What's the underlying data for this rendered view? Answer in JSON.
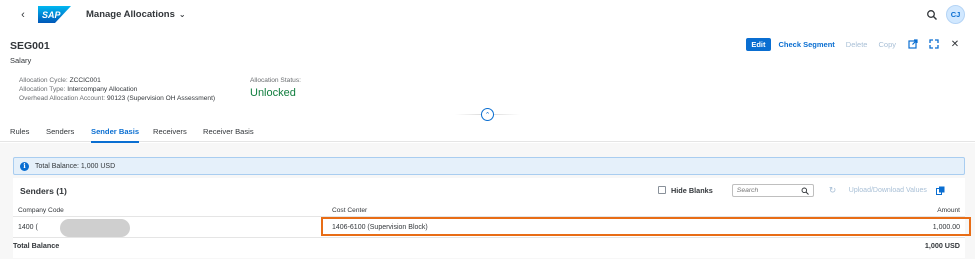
{
  "shell": {
    "back_icon": "chevron-left-icon",
    "logo_text": "SAP",
    "app_title": "Manage Allocations",
    "app_title_icon": "chevron-down-icon",
    "search_icon": "search-icon",
    "avatar_initials": "CJ"
  },
  "header": {
    "title": "SEG001",
    "subtitle": "Salary",
    "actions": {
      "edit": "Edit",
      "check_segment": "Check Segment",
      "delete": "Delete",
      "copy": "Copy"
    },
    "action_icons": [
      "share-icon",
      "fullscreen-icon",
      "close-icon"
    ],
    "attributes": [
      {
        "label": "Allocation Cycle:",
        "value": "ZCCIC001"
      },
      {
        "label": "Allocation Type:",
        "value": "Intercompany Allocation"
      },
      {
        "label": "Overhead Allocation Account:",
        "value": "90123 (Supervision OH Assessment)"
      }
    ],
    "status": {
      "label": "Allocation Status:",
      "value": "Unlocked"
    }
  },
  "tabs": [
    {
      "label": "Rules",
      "active": false
    },
    {
      "label": "Senders",
      "active": false
    },
    {
      "label": "Sender Basis",
      "active": true
    },
    {
      "label": "Receivers",
      "active": false
    },
    {
      "label": "Receiver Basis",
      "active": false
    }
  ],
  "info": {
    "icon": "information-icon",
    "text": "Total Balance: 1,000 USD"
  },
  "table": {
    "title": "Senders (1)",
    "hide_blanks_label": "Hide Blanks",
    "search_placeholder": "Search",
    "upload_download_label": "Upload/Download Values",
    "columns": [
      "Company Code",
      "Cost Center",
      "Amount"
    ],
    "rows": [
      {
        "company_code": "1400 (",
        "cost_center": "1406-6100 (Supervision Block)",
        "amount": "1,000.00"
      }
    ],
    "total_label": "Total Balance",
    "total_value": "1,000 USD"
  },
  "colors": {
    "accent": "#0a6ed1",
    "status_positive": "#107e3e",
    "highlight": "#e86d16",
    "info_bg": "#e5f0fa"
  }
}
